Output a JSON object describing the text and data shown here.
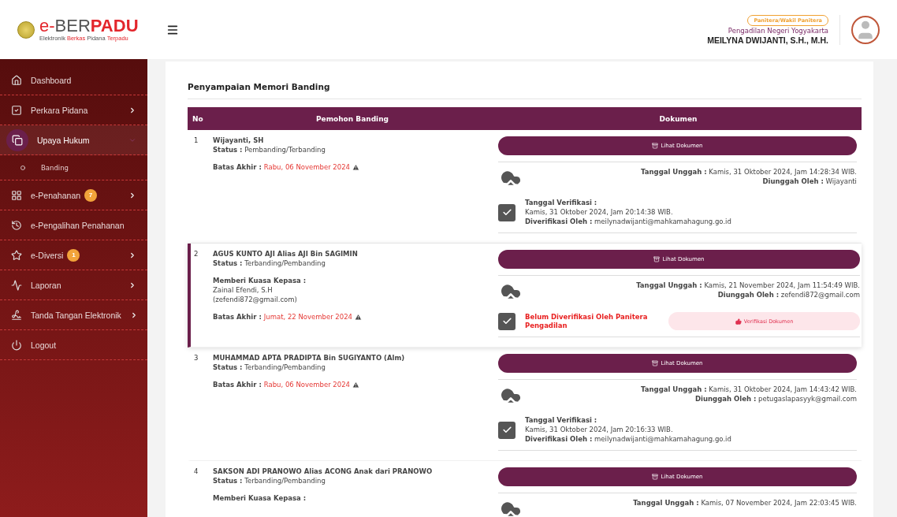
{
  "brand": {
    "name_prefix": "e-",
    "name_light": "BER",
    "name_bold": "PADU",
    "tagline": [
      {
        "text": "Elektronik",
        "accent": false
      },
      {
        "text": "Berkas",
        "accent": true
      },
      {
        "text": "Pidana",
        "accent": false
      },
      {
        "text": "Terpadu",
        "accent": true
      }
    ]
  },
  "user": {
    "role": "Panitera/Wakil Panitera",
    "court": "Pengadilan Negeri Yogyakarta",
    "name": "MEILYNA DWIJANTI, S.H., M.H."
  },
  "sidebar": {
    "items": [
      {
        "label": "Dashboard",
        "selected": false
      },
      {
        "label": "Perkara Pidana",
        "selected": false,
        "expanded": false
      },
      {
        "label": "Upaya Hukum",
        "selected": true,
        "expanded": true,
        "children": [
          {
            "label": "Banding",
            "selected": false
          }
        ]
      },
      {
        "label": "e-Penahanan",
        "selected": false,
        "expanded": false,
        "badge": "7"
      },
      {
        "label": "e-Pengalihan Penahanan",
        "selected": false
      },
      {
        "label": "e-Diversi",
        "selected": false,
        "expanded": false,
        "badge": "1"
      },
      {
        "label": "Laporan",
        "selected": false,
        "expanded": false
      },
      {
        "label": "Tanda Tangan Elektronik",
        "selected": false,
        "expanded": false
      },
      {
        "label": "Logout",
        "selected": false
      }
    ]
  },
  "page": {
    "title": "Penyampaian Memori Banding",
    "table": {
      "columns": [
        "No",
        "Pemohon Banding",
        "Dokumen"
      ],
      "rows": [
        {
          "no": "1",
          "selected": false,
          "name": "Wijayanti, SH",
          "status_label": "Status :",
          "status": "Pembanding/Terbanding",
          "deadline_label": "Batas Akhir :",
          "deadline": "Rabu, 06 November 2024",
          "doc_button": "Lihat Dokumen",
          "upload_label": "Tanggal Unggah :",
          "upload_date": "Kamis, 31 Oktober 2024, Jam 14:28:34 WIB.",
          "uploader_label": "Diunggah Oleh :",
          "uploader": "Wijayanti",
          "kind": "verified",
          "verify_label": "Tanggal Verifikasi :",
          "verify_date": "Kamis, 31 Oktober 2024, Jam 20:14:38 WIB.",
          "verifier_label": "Diverifikasi Oleh :",
          "verifier": "meilynadwijanti@mahkamahagung.go.id"
        },
        {
          "no": "2",
          "selected": true,
          "name": "AGUS KUNTO AJI Alias AJI Bin SAGIMIN",
          "status_label": "Status :",
          "status": "Terbanding/Pembanding",
          "attorney_label": "Memberi Kuasa Kepasa :",
          "attorney": "Zainal Efendi, S.H",
          "attorney_email": "(zefendi872@gmail.com)",
          "deadline_label": "Batas Akhir :",
          "deadline": "Jumat, 22 November 2024",
          "doc_button": "Lihat Dokumen",
          "upload_label": "Tanggal Unggah :",
          "upload_date": "Kamis, 21 November 2024, Jam 11:54:49 WIB.",
          "uploader_label": "Diunggah Oleh :",
          "uploader": "zefendi872@gmail.com",
          "kind": "unverified",
          "unverified_text": "Belum Diverifikasi Oleh Panitera Pengadilan",
          "verify_button": "Verifikasi Dokumen"
        },
        {
          "no": "3",
          "selected": false,
          "name": "MUHAMMAD APTA PRADIPTA Bin SUGIYANTO (Alm)",
          "status_label": "Status :",
          "status": "Terbanding/Pembanding",
          "deadline_label": "Batas Akhir :",
          "deadline": "Rabu, 06 November 2024",
          "doc_button": "Lihat Dokumen",
          "upload_label": "Tanggal Unggah :",
          "upload_date": "Kamis, 31 Oktober 2024, Jam 14:43:42 WIB.",
          "uploader_label": "Diunggah Oleh :",
          "uploader": "petugaslapasyyk@gmail.com",
          "kind": "verified",
          "verify_label": "Tanggal Verifikasi :",
          "verify_date": "Kamis, 31 Oktober 2024, Jam 20:16:33 WIB.",
          "verifier_label": "Diverifikasi Oleh :",
          "verifier": "meilynadwijanti@mahkamahagung.go.id"
        },
        {
          "no": "4",
          "selected": false,
          "name": "SAKSON ADI PRANOWO Alias ACONG Anak dari PRANOWO",
          "status_label": "Status :",
          "status": "Terbanding/Pembanding",
          "attorney_label": "Memberi Kuasa Kepasa :",
          "doc_button": "Lihat Dokumen",
          "upload_label": "Tanggal Unggah :",
          "upload_date": "Kamis, 07 November 2024, Jam 22:03:45 WIB."
        }
      ]
    }
  }
}
